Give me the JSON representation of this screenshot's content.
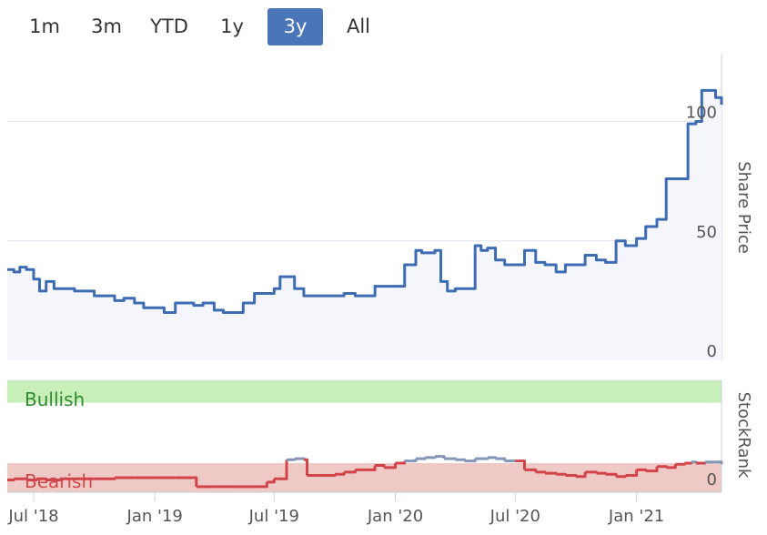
{
  "range_selector": {
    "buttons": [
      {
        "id": "1m",
        "label": "1m"
      },
      {
        "id": "3m",
        "label": "3m"
      },
      {
        "id": "ytd",
        "label": "YTD"
      },
      {
        "id": "1y",
        "label": "1y"
      },
      {
        "id": "3y",
        "label": "3y"
      },
      {
        "id": "all",
        "label": "All"
      }
    ],
    "active": "3y"
  },
  "colors": {
    "price_line": "#3d6cb3",
    "price_fill": "#f4f6fb",
    "bullish_band": "#c9efb9",
    "bearish_band": "#efc9c6",
    "bullish_text": "#2f8a2f",
    "bearish_text": "#cc4a4a",
    "rank_line": "#d2444a",
    "rank_line_high": "#8496b8",
    "grid": "#dde3ec",
    "axis": "#c7d0de"
  },
  "chart_data": [
    {
      "type": "line",
      "ylabel": "Share Price",
      "yticks": [
        0,
        50,
        100
      ],
      "ylim": [
        0,
        128
      ],
      "grid": true,
      "x": [
        "2018-05-22",
        "2018-06-01",
        "2018-06-10",
        "2018-06-20",
        "2018-07-01",
        "2018-07-10",
        "2018-07-20",
        "2018-08-01",
        "2018-08-15",
        "2018-09-01",
        "2018-09-15",
        "2018-10-01",
        "2018-10-15",
        "2018-11-01",
        "2018-11-15",
        "2018-12-01",
        "2018-12-15",
        "2019-01-01",
        "2019-01-15",
        "2019-02-01",
        "2019-02-15",
        "2019-03-01",
        "2019-03-15",
        "2019-04-01",
        "2019-04-15",
        "2019-05-01",
        "2019-05-15",
        "2019-06-01",
        "2019-06-15",
        "2019-07-01",
        "2019-07-10",
        "2019-07-20",
        "2019-08-01",
        "2019-08-15",
        "2019-09-01",
        "2019-09-15",
        "2019-10-01",
        "2019-10-15",
        "2019-11-01",
        "2019-11-15",
        "2019-12-01",
        "2019-12-15",
        "2020-01-01",
        "2020-01-15",
        "2020-02-01",
        "2020-02-10",
        "2020-02-20",
        "2020-03-01",
        "2020-03-10",
        "2020-03-20",
        "2020-04-01",
        "2020-04-15",
        "2020-05-01",
        "2020-05-10",
        "2020-05-20",
        "2020-06-01",
        "2020-06-15",
        "2020-07-01",
        "2020-07-15",
        "2020-08-01",
        "2020-08-15",
        "2020-09-01",
        "2020-09-15",
        "2020-10-01",
        "2020-10-15",
        "2020-11-01",
        "2020-11-15",
        "2020-12-01",
        "2020-12-15",
        "2021-01-01",
        "2021-01-15",
        "2021-02-01",
        "2021-02-15",
        "2021-03-01",
        "2021-03-10",
        "2021-03-20",
        "2021-04-01",
        "2021-04-10",
        "2021-04-20",
        "2021-05-01",
        "2021-05-10"
      ],
      "values": [
        38,
        37,
        39,
        38,
        34,
        29,
        33,
        30,
        30,
        29,
        29,
        27,
        27,
        25,
        26,
        24,
        22,
        22,
        20,
        24,
        24,
        23,
        24,
        21,
        20,
        20,
        24,
        28,
        28,
        30,
        35,
        35,
        30,
        27,
        27,
        27,
        27,
        28,
        27,
        27,
        31,
        31,
        31,
        40,
        46,
        45,
        45,
        46,
        33,
        29,
        30,
        30,
        48,
        46,
        47,
        42,
        40,
        40,
        46,
        41,
        40,
        37,
        40,
        40,
        44,
        42,
        41,
        50,
        48,
        51,
        56,
        59,
        76,
        76,
        76,
        99,
        100,
        113,
        113,
        110,
        107
      ]
    },
    {
      "type": "line",
      "ylabel": "StockRank",
      "yticks": [
        0
      ],
      "ylim": [
        0,
        100
      ],
      "bands": [
        {
          "label": "Bullish",
          "from": 80,
          "to": 100
        },
        {
          "label": "Bearish",
          "from": 0,
          "to": 26
        }
      ],
      "x": [
        "2018-05-22",
        "2018-06-01",
        "2018-06-20",
        "2018-07-05",
        "2018-07-20",
        "2018-08-10",
        "2018-09-01",
        "2018-10-01",
        "2018-11-01",
        "2018-12-01",
        "2019-01-01",
        "2019-02-01",
        "2019-02-28",
        "2019-03-05",
        "2019-03-15",
        "2019-04-01",
        "2019-05-01",
        "2019-05-20",
        "2019-06-01",
        "2019-06-20",
        "2019-07-01",
        "2019-07-05",
        "2019-07-20",
        "2019-08-01",
        "2019-08-15",
        "2019-08-20",
        "2019-09-01",
        "2019-10-01",
        "2019-10-15",
        "2019-11-01",
        "2019-11-15",
        "2019-12-01",
        "2019-12-15",
        "2020-01-01",
        "2020-01-15",
        "2020-02-01",
        "2020-02-15",
        "2020-03-01",
        "2020-03-15",
        "2020-04-01",
        "2020-04-15",
        "2020-05-01",
        "2020-05-20",
        "2020-06-01",
        "2020-06-15",
        "2020-07-01",
        "2020-07-15",
        "2020-08-01",
        "2020-08-15",
        "2020-09-01",
        "2020-09-15",
        "2020-10-01",
        "2020-10-15",
        "2020-11-01",
        "2020-11-15",
        "2020-12-01",
        "2020-12-15",
        "2021-01-01",
        "2021-01-15",
        "2021-02-01",
        "2021-02-15",
        "2021-03-01",
        "2021-03-15",
        "2021-03-25",
        "2021-04-01",
        "2021-04-15",
        "2021-05-01",
        "2021-05-10"
      ],
      "values": [
        11,
        12,
        11,
        12,
        11,
        12,
        12,
        12,
        13,
        13,
        13,
        13,
        13,
        5,
        5,
        5,
        5,
        5,
        5,
        9,
        12,
        12,
        29,
        30,
        29,
        15,
        15,
        16,
        18,
        20,
        20,
        24,
        22,
        26,
        28,
        30,
        31,
        32,
        30,
        29,
        28,
        30,
        31,
        30,
        28,
        28,
        20,
        18,
        17,
        16,
        15,
        14,
        18,
        17,
        16,
        14,
        15,
        20,
        19,
        23,
        22,
        25,
        26,
        27,
        26,
        27,
        27,
        25
      ]
    }
  ],
  "x_axis": {
    "ticks": [
      {
        "date": "2018-07-01",
        "label": "Jul '18"
      },
      {
        "date": "2019-01-01",
        "label": "Jan '19"
      },
      {
        "date": "2019-07-01",
        "label": "Jul '19"
      },
      {
        "date": "2020-01-01",
        "label": "Jan '20"
      },
      {
        "date": "2020-07-01",
        "label": "Jul '20"
      },
      {
        "date": "2021-01-01",
        "label": "Jan '21"
      }
    ]
  }
}
